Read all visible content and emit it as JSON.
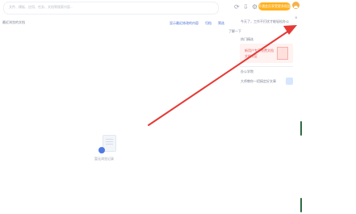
{
  "search": {
    "placeholder": "文件、模板、应用、任务、文档等搜索内容..."
  },
  "top_bar": {
    "icons": [
      "refresh-icon",
      "download-icon",
      "settings-icon"
    ],
    "upgrade_label": "开通会员享受更多权益"
  },
  "content": {
    "breadcrumb": "最近浏览的文档",
    "toolbar_actions": [
      {
        "label": "显示最近修改的内容"
      },
      {
        "label": "归档"
      },
      {
        "label": "筛选"
      }
    ],
    "empty_state_label": "暂无浏览记录"
  },
  "side_panel": {
    "title": "今天了，工作不打扰才能轻松办公",
    "section_label": "了解一下",
    "card1": {
      "title": "热门精选",
      "line1": "新用户专享免费文档",
      "line2": "文档专区"
    },
    "card2": {
      "label": "办公学院",
      "desc": "大师教你一招搞定好文章"
    }
  },
  "colors": {
    "accent": "#ffb01f",
    "arrow": "#e53935",
    "brand_blue": "#4f7ae6",
    "scroll": "#2f6b41"
  }
}
